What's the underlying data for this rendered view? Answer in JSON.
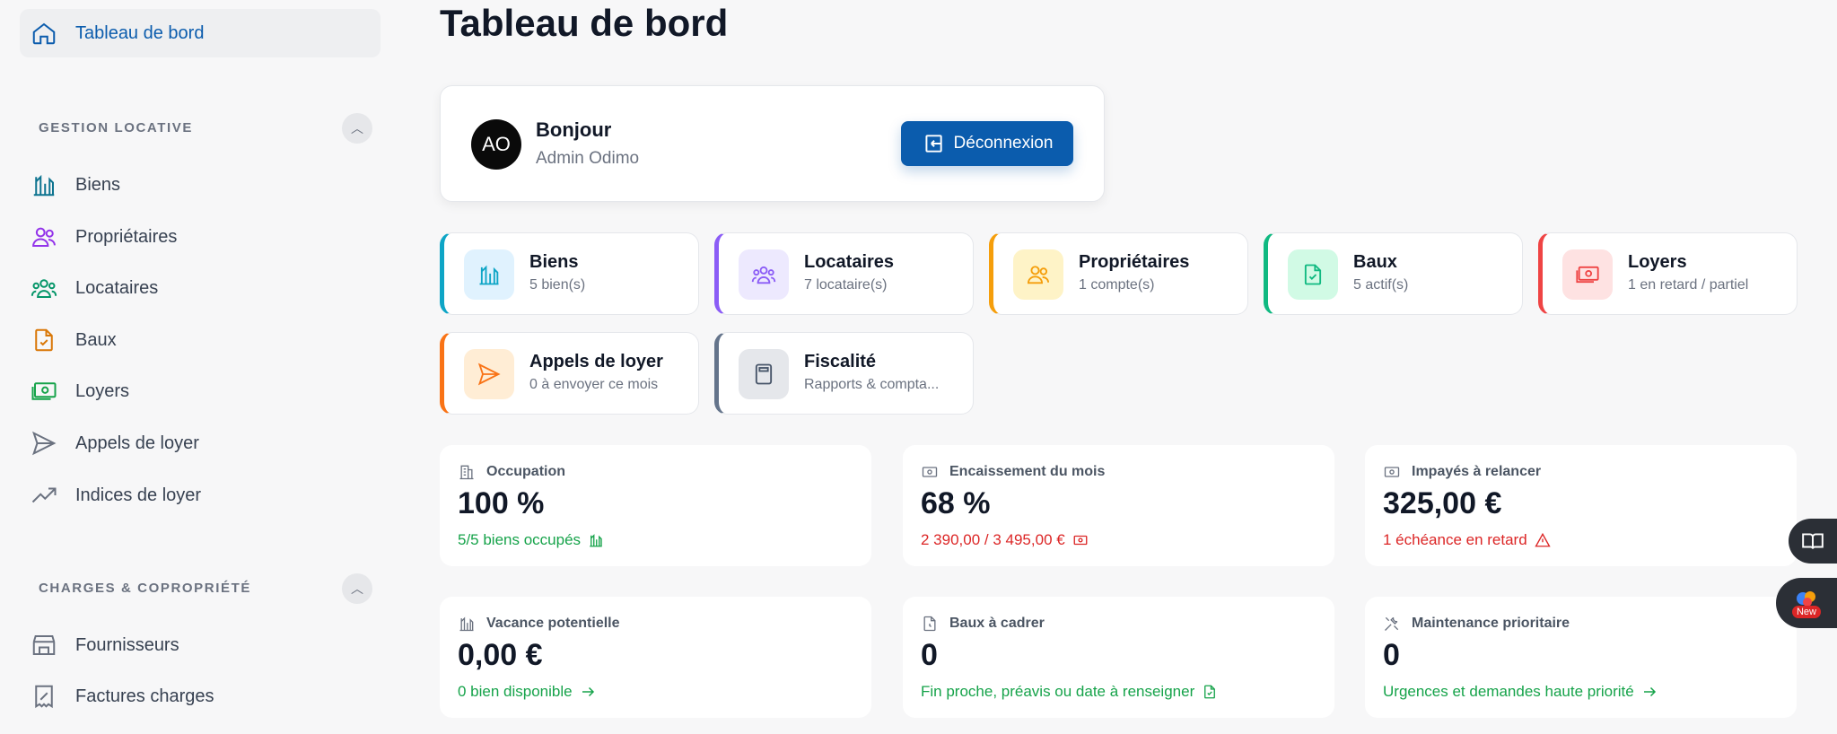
{
  "sidebar": {
    "dashboard": "Tableau de bord",
    "sections": [
      {
        "title": "GESTION LOCATIVE",
        "items": [
          "Biens",
          "Propriétaires",
          "Locataires",
          "Baux",
          "Loyers",
          "Appels de loyer",
          "Indices de loyer"
        ]
      },
      {
        "title": "CHARGES & COPROPRIÉTÉ",
        "items": [
          "Fournisseurs",
          "Factures charges"
        ]
      }
    ]
  },
  "page": {
    "title": "Tableau de bord"
  },
  "user": {
    "initials": "AO",
    "greeting": "Bonjour",
    "name": "Admin Odimo",
    "logout_label": "Déconnexion"
  },
  "tiles": [
    {
      "title": "Biens",
      "sub": "5 bien(s)",
      "color": "#0ea5c6"
    },
    {
      "title": "Locataires",
      "sub": "7 locataire(s)",
      "color": "#8b5cf6"
    },
    {
      "title": "Propriétaires",
      "sub": "1 compte(s)",
      "color": "#f59e0b"
    },
    {
      "title": "Baux",
      "sub": "5 actif(s)",
      "color": "#10b981"
    },
    {
      "title": "Loyers",
      "sub": "1 en retard / partiel",
      "color": "#ef4444"
    },
    {
      "title": "Appels de loyer",
      "sub": "0 à envoyer ce mois",
      "color": "#f97316"
    },
    {
      "title": "Fiscalité",
      "sub": "Rapports & compta...",
      "color": "#64748b"
    }
  ],
  "stats": [
    {
      "label": "Occupation",
      "value": "100 %",
      "foot": "5/5 biens occupés"
    },
    {
      "label": "Encaissement du mois",
      "value": "68 %",
      "foot": "2 390,00 / 3 495,00 €"
    },
    {
      "label": "Impayés à relancer",
      "value": "325,00 €",
      "foot": "1 échéance en retard"
    },
    {
      "label": "Vacance potentielle",
      "value": "0,00 €",
      "foot": "0 bien disponible"
    },
    {
      "label": "Baux à cadrer",
      "value": "0",
      "foot": "Fin proche, préavis ou date à renseigner"
    },
    {
      "label": "Maintenance prioritaire",
      "value": "0",
      "foot": "Urgences et demandes haute priorité"
    }
  ],
  "widgets": {
    "new_badge": "New"
  }
}
